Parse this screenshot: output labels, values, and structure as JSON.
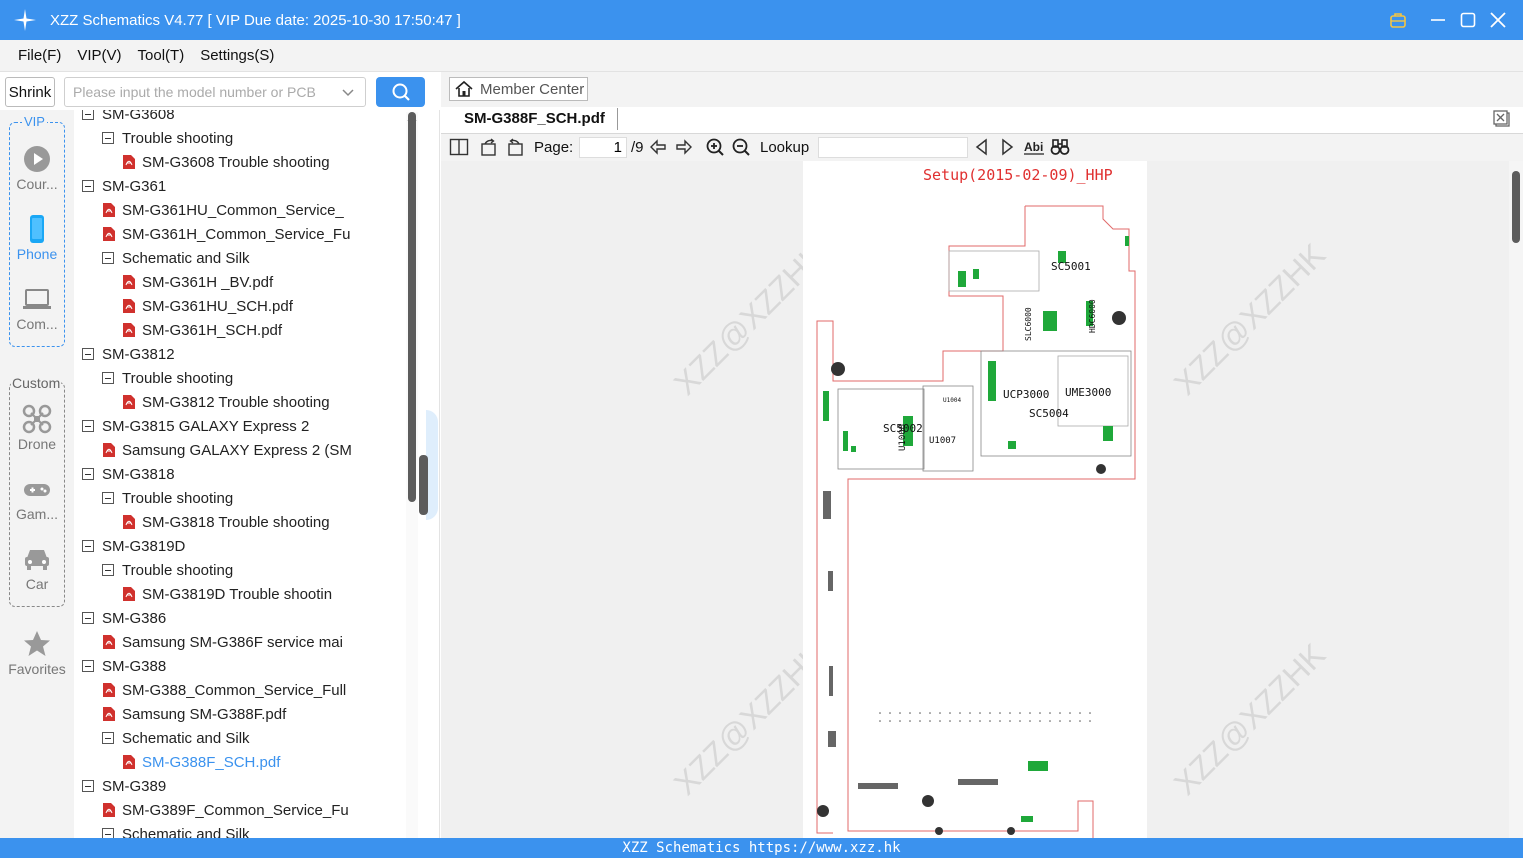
{
  "app": {
    "title": "XZZ Schematics V4.77 [ VIP Due date: 2025-10-30 17:50:47 ]"
  },
  "menu": {
    "file": "File(F)",
    "vip": "VIP(V)",
    "tool": "Tool(T)",
    "settings": "Settings(S)"
  },
  "search": {
    "shrink_label": "Shrink",
    "placeholder": "Please input the model number or PCB"
  },
  "rail": {
    "vip_tag": "VIP",
    "custom_tag": "Custom",
    "items": [
      {
        "label": "Cour..."
      },
      {
        "label": "Phone"
      },
      {
        "label": "Com..."
      },
      {
        "label": "Drone"
      },
      {
        "label": "Gam..."
      },
      {
        "label": "Car"
      },
      {
        "label": "Favorites"
      }
    ]
  },
  "tree": {
    "rows": [
      {
        "text": "SM-G3608",
        "kind": "folder"
      },
      {
        "text": "Trouble shooting",
        "kind": "folder"
      },
      {
        "text": "SM-G3608 Trouble shooting",
        "kind": "pdf"
      },
      {
        "text": "SM-G361",
        "kind": "folder"
      },
      {
        "text": "SM-G361HU_Common_Service_",
        "kind": "pdf"
      },
      {
        "text": "SM-G361H_Common_Service_Fu",
        "kind": "pdf"
      },
      {
        "text": "Schematic and Silk",
        "kind": "folder"
      },
      {
        "text": "SM-G361H _BV.pdf",
        "kind": "pdf"
      },
      {
        "text": "SM-G361HU_SCH.pdf",
        "kind": "pdf"
      },
      {
        "text": "SM-G361H_SCH.pdf",
        "kind": "pdf"
      },
      {
        "text": "SM-G3812",
        "kind": "folder"
      },
      {
        "text": "Trouble shooting",
        "kind": "folder"
      },
      {
        "text": "SM-G3812 Trouble shooting",
        "kind": "pdf"
      },
      {
        "text": "SM-G3815 GALAXY Express 2",
        "kind": "folder"
      },
      {
        "text": "Samsung GALAXY Express 2 (SM",
        "kind": "pdf"
      },
      {
        "text": "SM-G3818",
        "kind": "folder"
      },
      {
        "text": "Trouble shooting",
        "kind": "folder"
      },
      {
        "text": "SM-G3818 Trouble shooting",
        "kind": "pdf"
      },
      {
        "text": "SM-G3819D",
        "kind": "folder"
      },
      {
        "text": "Trouble shooting",
        "kind": "folder"
      },
      {
        "text": "SM-G3819D Trouble shootin",
        "kind": "pdf"
      },
      {
        "text": "SM-G386",
        "kind": "folder"
      },
      {
        "text": "Samsung SM-G386F service mai",
        "kind": "pdf"
      },
      {
        "text": "SM-G388",
        "kind": "folder"
      },
      {
        "text": "SM-G388_Common_Service_Full",
        "kind": "pdf"
      },
      {
        "text": "Samsung SM-G388F.pdf",
        "kind": "pdf"
      },
      {
        "text": "Schematic and Silk",
        "kind": "folder"
      },
      {
        "text": "SM-G388F_SCH.pdf",
        "kind": "pdf",
        "selected": true
      },
      {
        "text": "SM-G389",
        "kind": "folder"
      },
      {
        "text": "SM-G389F_Common_Service_Fu",
        "kind": "pdf"
      },
      {
        "text": "Schematic and Silk",
        "kind": "folder"
      }
    ]
  },
  "viewer": {
    "member_center": "Member Center",
    "tab_title": "SM-G388F_SCH.pdf",
    "page_label": "Page:",
    "page_value": "1",
    "page_total": "/9",
    "lookup_label": "Lookup",
    "lookup_value": "",
    "header_text": "Setup(2015-02-09)_HHP",
    "components": [
      "SC5001",
      "SLC6000",
      "HDC6000",
      "UCP3000",
      "UME3000",
      "SC5004",
      "SC5002",
      "U1007",
      "U1004",
      "U1008"
    ],
    "watermark": "XZZ@XZZHK"
  },
  "status": {
    "text": "XZZ Schematics https://www.xzz.hk"
  },
  "colors": {
    "accent": "#3b92ee",
    "pdf_red": "#d0312d",
    "board_outline": "#e06a6a",
    "component_green": "#1fa83a"
  }
}
